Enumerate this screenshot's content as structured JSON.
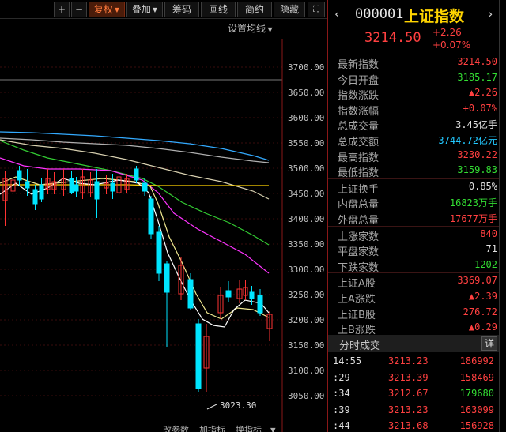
{
  "toolbar": {
    "plus": "+",
    "minus": "−",
    "adjust": "复权",
    "overlay": "叠加",
    "chips": "筹码",
    "draw": "画线",
    "simple": "简约",
    "hide": "隐藏"
  },
  "ma_setting": "设置均线",
  "chart_data": {
    "type": "candlestick",
    "y_ticks": [
      "3700.00",
      "3650.00",
      "3600.00",
      "3550.00",
      "3500.00",
      "3450.00",
      "3400.00",
      "3350.00",
      "3300.00",
      "3250.00",
      "3200.00",
      "3150.00",
      "3100.00",
      "3050.00"
    ],
    "low_marker": "3023.30",
    "bottom_labels": [
      "改参数",
      "加指标",
      "换指标"
    ],
    "colors": {
      "up": "#ff3333",
      "down": "#00e5ff",
      "ma5": "#ffffff",
      "ma10": "#ffd400",
      "ma20": "#ff33ff",
      "ma30": "#33cc33",
      "ma60": "#b0b0b0",
      "ma120": "#33aaff"
    }
  },
  "panel": {
    "code": "000001",
    "name": "上证指数",
    "price": "3214.50",
    "change": "+2.26",
    "change_pct": "+0.07%",
    "stats": [
      {
        "label": "最新指数",
        "value": "3214.50",
        "color": "red"
      },
      {
        "label": "今日开盘",
        "value": "3185.17",
        "color": "green"
      },
      {
        "label": "指数涨跌",
        "value": "▲2.26",
        "color": "red"
      },
      {
        "label": "指数涨幅",
        "value": "+0.07%",
        "color": "red"
      },
      {
        "label": "总成交量",
        "value": "3.45亿手",
        "color": "white"
      },
      {
        "label": "总成交额",
        "value": "3744.72亿元",
        "color": "cyan"
      },
      {
        "label": "最高指数",
        "value": "3230.22",
        "color": "red"
      },
      {
        "label": "最低指数",
        "value": "3159.83",
        "color": "green"
      }
    ],
    "stats2": [
      {
        "label": "上证换手",
        "value": "0.85%",
        "color": "white"
      },
      {
        "label": "内盘总量",
        "value": "16823万手",
        "color": "green"
      },
      {
        "label": "外盘总量",
        "value": "17677万手",
        "color": "red"
      }
    ],
    "stats3": [
      {
        "label": "上涨家数",
        "value": "840",
        "color": "red"
      },
      {
        "label": "平盘家数",
        "value": "71",
        "color": "white"
      },
      {
        "label": "下跌家数",
        "value": "1202",
        "color": "green"
      }
    ],
    "stats4": [
      {
        "label": "上证A股",
        "value": "3369.07",
        "color": "red"
      },
      {
        "label": "上A涨跌",
        "value": "▲2.39",
        "color": "red"
      },
      {
        "label": "上证B股",
        "value": "276.72",
        "color": "red"
      },
      {
        "label": "上B涨跌",
        "value": "▲0.29",
        "color": "red"
      }
    ],
    "ticks_title": "分时成交",
    "ticks_detail": "详",
    "ticks": [
      {
        "time": "14:55",
        "price": "3213.23",
        "vol": "186992",
        "dir": "up"
      },
      {
        "time": ":29",
        "price": "3213.39",
        "vol": "158469",
        "dir": "up"
      },
      {
        "time": ":34",
        "price": "3212.67",
        "vol": "179680",
        "dir": "down"
      },
      {
        "time": ":39",
        "price": "3213.23",
        "vol": "163099",
        "dir": "up"
      },
      {
        "time": ":44",
        "price": "3213.68",
        "vol": "156928",
        "dir": "up"
      }
    ]
  }
}
